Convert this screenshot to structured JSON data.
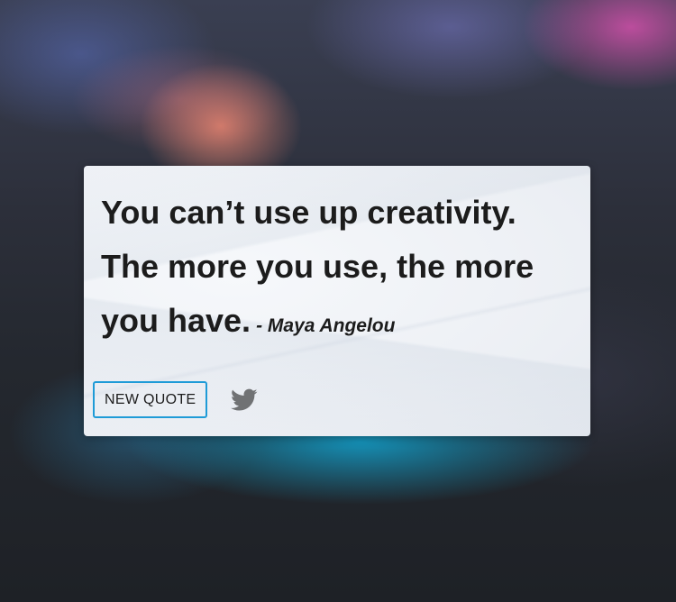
{
  "quote": {
    "text": "You can’t use up creativity. The more you use, the more you have.",
    "author": "- Maya Angelou"
  },
  "actions": {
    "new_quote_label": "NEW QUOTE",
    "tweet_icon": "twitter-icon"
  },
  "colors": {
    "button_border": "#1e9bd7",
    "text": "#1c1c1c",
    "icon": "#707274"
  }
}
